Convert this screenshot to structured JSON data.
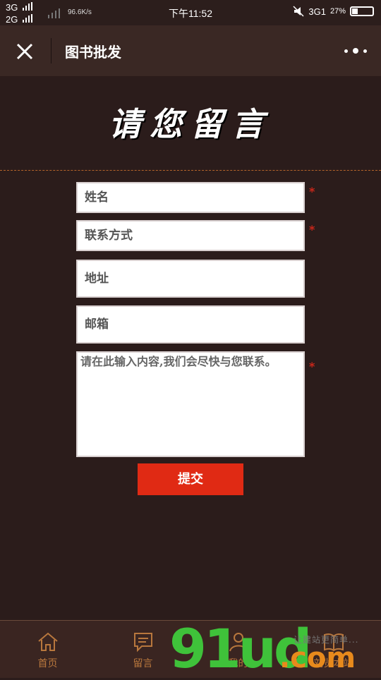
{
  "status_bar": {
    "sim1": "3G",
    "sim2": "2G",
    "net_speed": "96.6K/s",
    "time": "下午11:52",
    "network": "3G1",
    "battery": "27%",
    "battery_level": 0.27
  },
  "header": {
    "title": "图书批发",
    "close_icon": "close-icon",
    "more_icon": "more-dots-icon"
  },
  "hero": {
    "title": "请您留言"
  },
  "form": {
    "name_placeholder": "姓名",
    "contact_placeholder": "联系方式",
    "address_placeholder": "地址",
    "email_placeholder": "邮箱",
    "message_placeholder": "请在此输入内容,我们会尽快与您联系。",
    "required_mark": "*",
    "submit_label": "提交"
  },
  "bottom_nav": [
    {
      "label": "首页",
      "icon": "home-icon"
    },
    {
      "label": "留言",
      "icon": "message-icon"
    },
    {
      "label": "我的",
      "icon": "user-icon"
    },
    {
      "label": "刘览本站",
      "icon": "book-icon"
    }
  ],
  "watermark": {
    "logo": "91ud",
    "suffix": ".com",
    "slogan": "让建站更简单..."
  },
  "colors": {
    "background": "#2b1c1b",
    "header_bg": "#3a2824",
    "accent_red": "#e02a14",
    "nav_text": "#b8773d",
    "dash_line": "#b5642a"
  }
}
